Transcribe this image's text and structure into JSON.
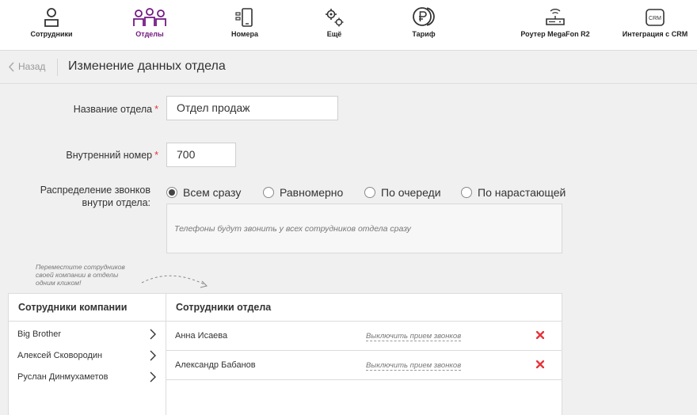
{
  "nav": {
    "items": [
      {
        "label": "Сотрудники",
        "icon": "user-icon"
      },
      {
        "label": "Отделы",
        "icon": "group-icon",
        "active": true
      },
      {
        "label": "Номера",
        "icon": "phone-number-icon"
      },
      {
        "label": "Ещё",
        "icon": "gears-icon"
      },
      {
        "label": "Тариф",
        "icon": "ruble-icon"
      },
      {
        "label": "Роутер MegaFon R2",
        "icon": "router-icon"
      },
      {
        "label": "Интеграция с CRM",
        "icon": "crm-icon"
      }
    ]
  },
  "header": {
    "back_label": "Назад",
    "title": "Изменение данных отдела"
  },
  "form": {
    "name_label": "Название отдела",
    "name_value": "Отдел продаж",
    "ext_label": "Внутренний номер",
    "ext_value": "700",
    "required_mark": "*",
    "dist_label_line1": "Распределение звонков",
    "dist_label_line2": "внутри отдела:",
    "dist_options": [
      "Всем сразу",
      "Равномерно",
      "По очереди",
      "По нарастающей"
    ],
    "dist_selected": "Всем сразу",
    "dist_hint": "Телефоны будут звонить у всех сотрудников отдела сразу"
  },
  "drag_hint": "Переместите сотрудников своей компании в отделы одним кликом!",
  "company": {
    "title": "Сотрудники компании",
    "employees": [
      "Big Brother",
      "Алексей Сковородин",
      "Руслан Динмухаметов"
    ]
  },
  "department": {
    "title": "Сотрудники отдела",
    "members": [
      {
        "name": "Анна Исаева",
        "action": "Выключить прием звонков"
      },
      {
        "name": "Александр Бабанов",
        "action": "Выключить прием звонков"
      }
    ]
  },
  "colors": {
    "accent": "#731982",
    "delete": "#e6353b"
  }
}
